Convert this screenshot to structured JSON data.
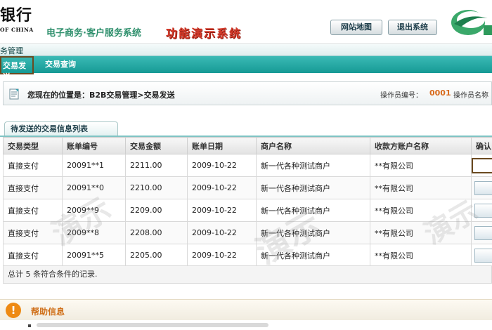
{
  "header": {
    "bank_name": "银行",
    "bank_sub": "OF CHINA",
    "system_title": "电子商务·客户服务系统",
    "demo_title": "功能演示系统",
    "sitemap_label": "网站地图",
    "logout_label": "退出系统",
    "brand_color": "#2e8f6c",
    "accent_red": "#d43a2a"
  },
  "nav": {
    "section_label": "务管理",
    "tabs": [
      {
        "label": "交易发送",
        "active": true
      },
      {
        "label": "交易查询",
        "active": false
      }
    ],
    "bar_color": "#1ba39d"
  },
  "location": {
    "text": "您现在的位置是：B2B交易管理>交易发送",
    "operator_id_label": "操作员编号：",
    "operator_id": "0001",
    "operator_name_label": "操作员名称"
  },
  "list": {
    "tab_label": "待发送的交易信息列表",
    "columns": [
      "交易类型",
      "账单编号",
      "交易金额",
      "账单日期",
      "商户名称",
      "收款方账户名称",
      "确认"
    ],
    "rows": [
      {
        "type": "直接支付",
        "bill_no": "20091**1",
        "amount": "2211.00",
        "date": "2009-10-22",
        "merchant": "新一代各种测试商户",
        "payee": "**有限公司"
      },
      {
        "type": "直接支付",
        "bill_no": "20091**0",
        "amount": "2210.00",
        "date": "2009-10-22",
        "merchant": "新一代各种测试商户",
        "payee": "**有限公司"
      },
      {
        "type": "直接支付",
        "bill_no": "2009**9",
        "amount": "2209.00",
        "date": "2009-10-22",
        "merchant": "新一代各种测试商户",
        "payee": "**有限公司"
      },
      {
        "type": "直接支付",
        "bill_no": "2009**8",
        "amount": "2208.00",
        "date": "2009-10-22",
        "merchant": "新一代各种测试商户",
        "payee": "**有限公司"
      },
      {
        "type": "直接支付",
        "bill_no": "20091**5",
        "amount": "2205.00",
        "date": "2009-10-22",
        "merchant": "新一代各种测试商户",
        "payee": "**有限公司"
      }
    ],
    "summary": "总计  5 条符合条件的记录."
  },
  "watermark": {
    "text": "演示"
  },
  "help": {
    "icon": "!",
    "title": "帮助信息"
  }
}
